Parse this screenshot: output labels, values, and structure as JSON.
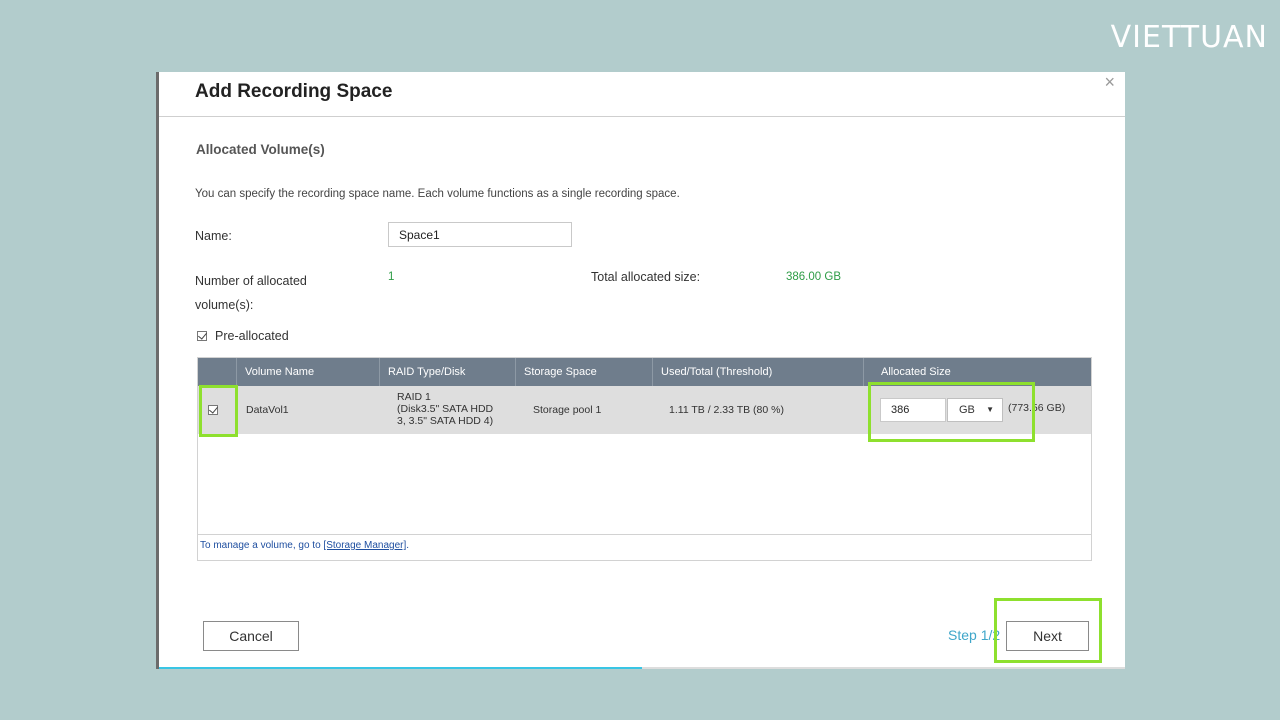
{
  "brand": "VIETTUAN",
  "dialog": {
    "title": "Add Recording Space",
    "close_label": "×",
    "section_title": "Allocated Volume(s)",
    "description": "You can specify the recording space name. Each volume functions as a single recording space.",
    "name_label": "Name:",
    "name_value": "Space1",
    "num_volumes_label_line1": "Number of allocated",
    "num_volumes_label_line2": "volume(s):",
    "num_volumes_value": "1",
    "total_size_label": "Total allocated size:",
    "total_size_value": "386.00 GB",
    "preallocated_label": "Pre-allocated",
    "preallocated_checked": true
  },
  "table": {
    "columns": [
      "Volume Name",
      "RAID Type/Disk",
      "Storage Space",
      "Used/Total (Threshold)",
      "Allocated Size"
    ],
    "rows": [
      {
        "checked": true,
        "volume_name": "DataVol1",
        "raid_line1": "RAID 1",
        "raid_line2": "(Disk3.5\" SATA HDD",
        "raid_line3": "3, 3.5\" SATA HDD 4)",
        "storage_space": "Storage pool 1",
        "used_total": "1.11 TB / 2.33 TB (80 %)",
        "allocated_value": "386",
        "allocated_unit": "GB",
        "allocated_max": "(773.56 GB)"
      }
    ],
    "footnote_prefix": "To manage a volume, go to ",
    "footnote_link": "[Storage Manager]",
    "footnote_suffix": "."
  },
  "footer": {
    "cancel_label": "Cancel",
    "step_label": "Step 1/2",
    "next_label": "Next",
    "progress_fraction": 0.5
  },
  "colors": {
    "highlight": "#8ee02e",
    "accent": "#3fa6c9",
    "value_green": "#2e9c46"
  }
}
